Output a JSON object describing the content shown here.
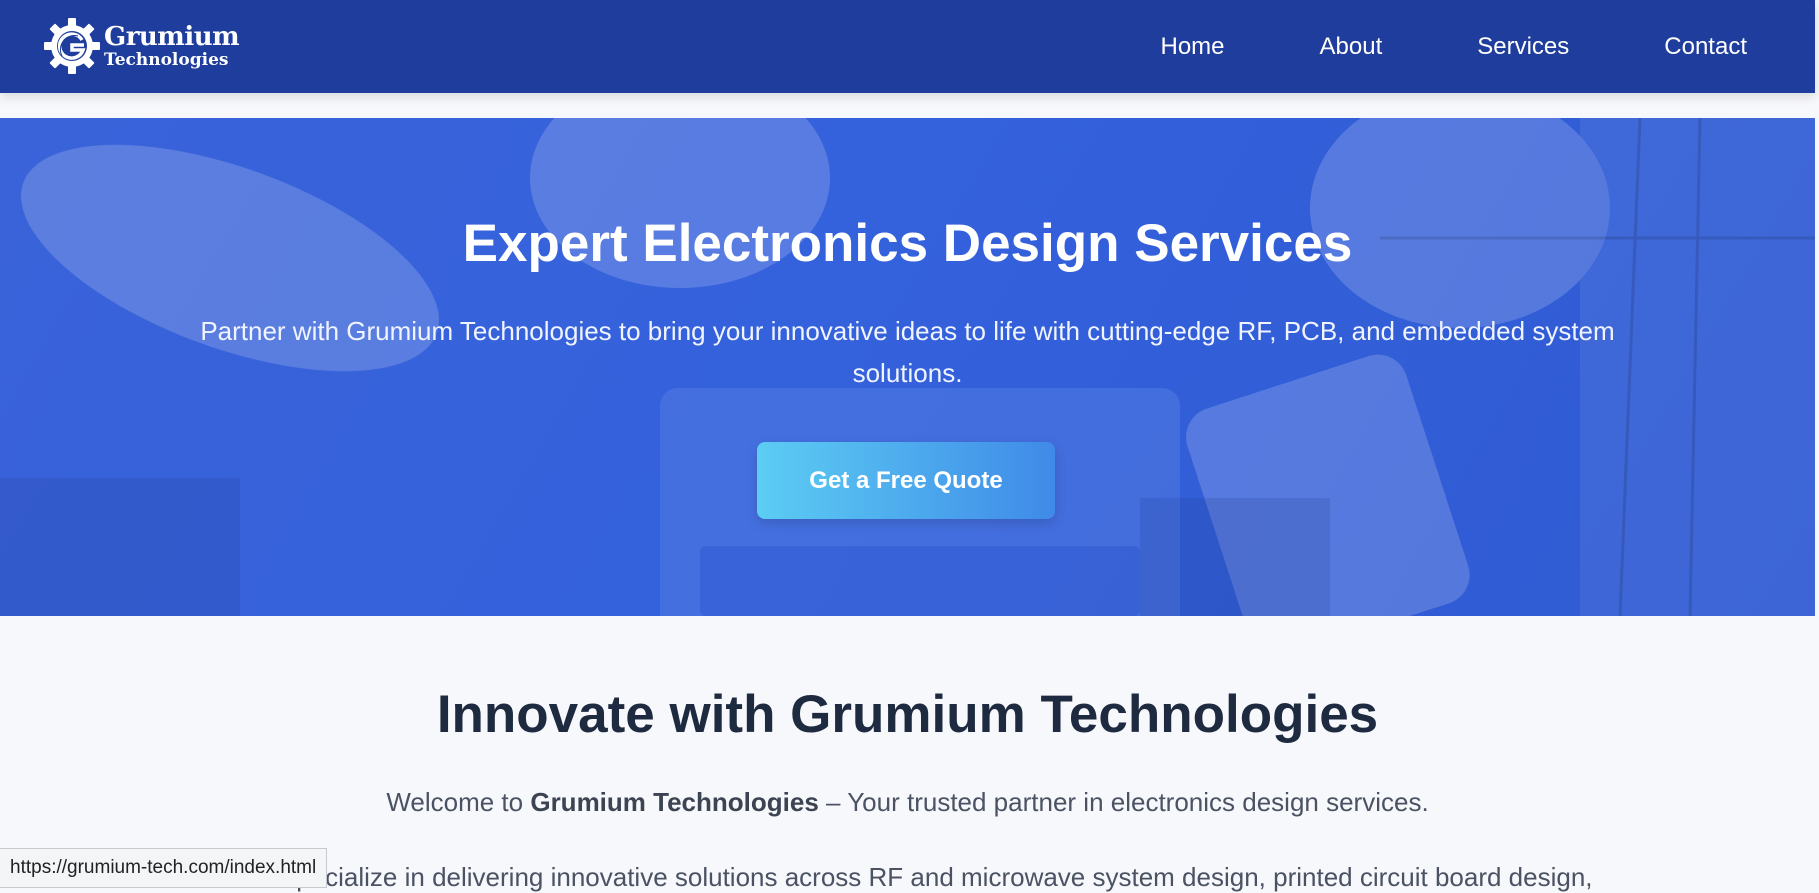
{
  "nav": {
    "logo_line1": "Grumium",
    "logo_line2": "Technologies",
    "links": [
      "Home",
      "About",
      "Services",
      "Contact"
    ]
  },
  "hero": {
    "title": "Expert Electronics Design Services",
    "subtitle": "Partner with Grumium Technologies to bring your innovative ideas to life with cutting-edge RF, PCB, and embedded system solutions.",
    "cta_label": "Get a Free Quote"
  },
  "intro": {
    "title": "Innovate with Grumium Technologies",
    "welcome_prefix": "Welcome to ",
    "welcome_brand": "Grumium Technologies",
    "welcome_suffix": " – Your trusted partner in electronics design services.",
    "para2_partial": "We specialize in delivering innovative solutions across RF and microwave system design, printed circuit board design,"
  },
  "status_bar": {
    "url": "https://grumium-tech.com/index.html"
  },
  "colors": {
    "nav_bg": "#1f3d9c",
    "hero_bg": "#3461dc",
    "cta_start": "#5ccdf3",
    "cta_end": "#3f8ae8",
    "heading_dark": "#1d2a3f",
    "body_text": "#4a5263"
  },
  "icons": {
    "logo": "gear-g-logo-icon"
  }
}
